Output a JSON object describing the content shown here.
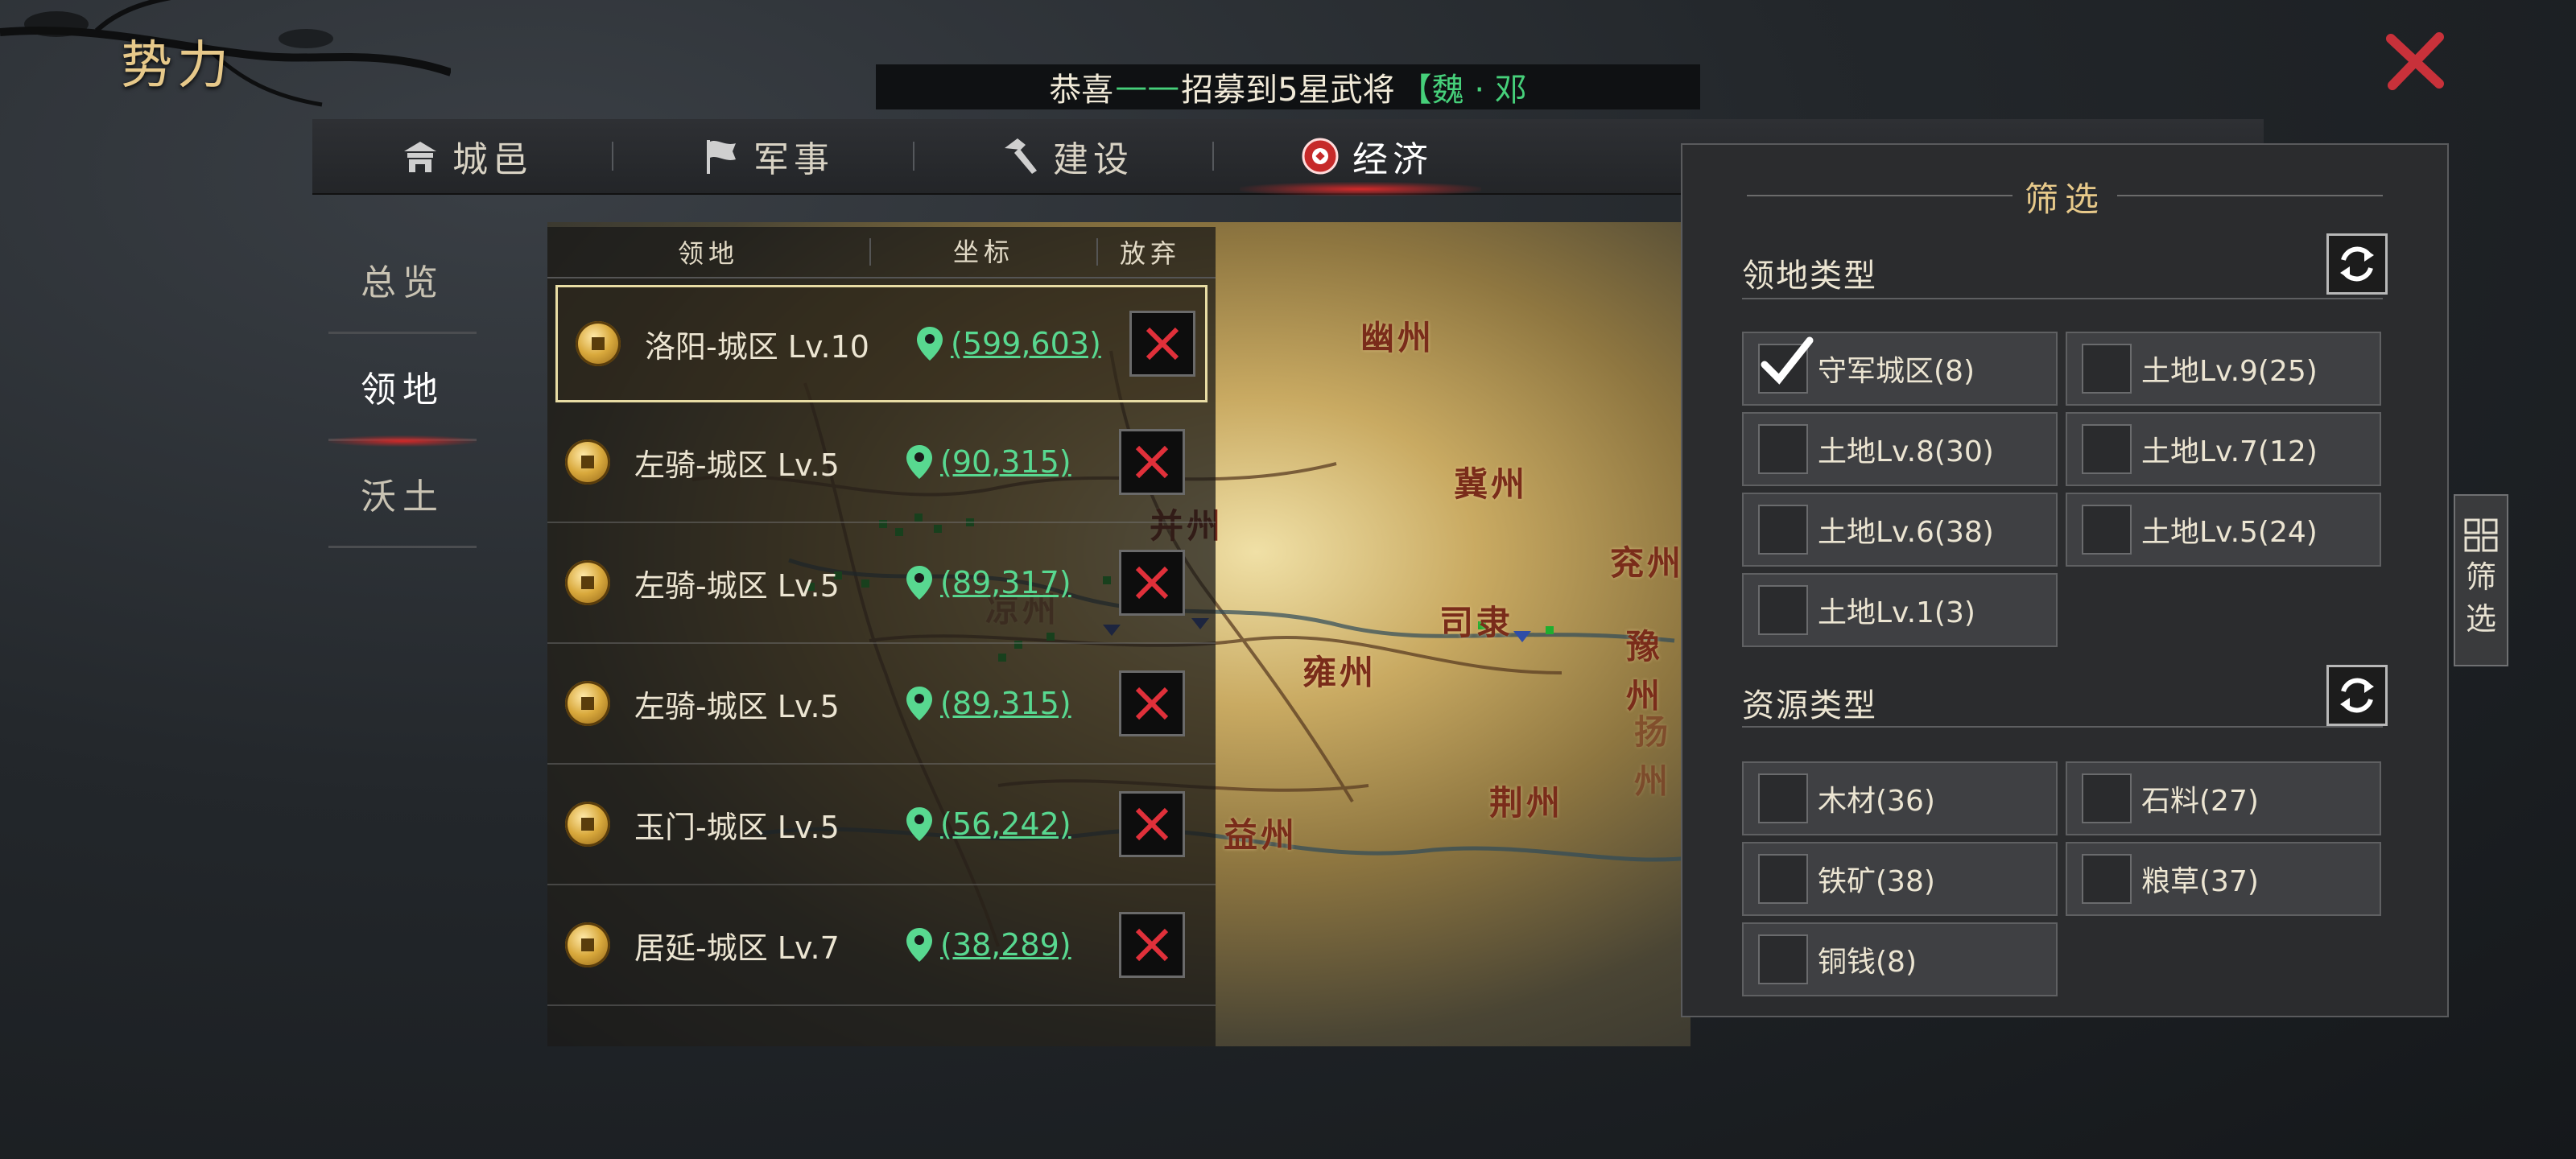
{
  "header": {
    "title": "势力"
  },
  "ticker": {
    "prefix": "恭喜",
    "dash": "——",
    "message": "招募到5星武将",
    "tag": "【魏 · 邓"
  },
  "tabs": [
    {
      "label": "城邑",
      "icon": "city-gate-icon"
    },
    {
      "label": "军事",
      "icon": "flag-icon"
    },
    {
      "label": "建设",
      "icon": "hammer-icon"
    },
    {
      "label": "经济",
      "icon": "coin-emblem-icon",
      "active": true
    }
  ],
  "side_nav": [
    {
      "label": "总览"
    },
    {
      "label": "领地",
      "active": true
    },
    {
      "label": "沃土"
    }
  ],
  "list": {
    "headers": {
      "territory": "领地",
      "coords": "坐标",
      "abandon": "放弃"
    },
    "rows": [
      {
        "name": "洛阳-城区 Lv.10",
        "coords": "(599,603)",
        "selected": true
      },
      {
        "name": "左骑-城区 Lv.5",
        "coords": "(90,315)"
      },
      {
        "name": "左骑-城区 Lv.5",
        "coords": "(89,317)"
      },
      {
        "name": "左骑-城区 Lv.5",
        "coords": "(89,315)"
      },
      {
        "name": "玉门-城区 Lv.5",
        "coords": "(56,242)"
      },
      {
        "name": "居延-城区 Lv.7",
        "coords": "(38,289)"
      }
    ]
  },
  "map": {
    "regions": [
      "幽州",
      "冀州",
      "并州",
      "凉州",
      "雍州",
      "司隶",
      "兖州",
      "豫州",
      "荆州",
      "益州",
      "扬州"
    ]
  },
  "filter": {
    "title": "筛选",
    "territory_type": {
      "label": "领地类型",
      "options": [
        {
          "label": "守军城区(8)",
          "checked": true
        },
        {
          "label": "土地Lv.9(25)",
          "checked": false
        },
        {
          "label": "土地Lv.8(30)",
          "checked": false
        },
        {
          "label": "土地Lv.7(12)",
          "checked": false
        },
        {
          "label": "土地Lv.6(38)",
          "checked": false
        },
        {
          "label": "土地Lv.5(24)",
          "checked": false
        },
        {
          "label": "土地Lv.1(3)",
          "checked": false
        }
      ]
    },
    "resource_type": {
      "label": "资源类型",
      "options": [
        {
          "label": "木材(36)",
          "checked": false
        },
        {
          "label": "石料(27)",
          "checked": false
        },
        {
          "label": "铁矿(38)",
          "checked": false
        },
        {
          "label": "粮草(37)",
          "checked": false
        },
        {
          "label": "铜钱(8)",
          "checked": false
        }
      ]
    },
    "side_tab": {
      "label1": "筛",
      "label2": "选"
    }
  },
  "colors": {
    "accent_gold": "#e7c98a",
    "coord_green": "#58d890",
    "close_red": "#c8313a",
    "active_glow": "#d42a2a"
  }
}
